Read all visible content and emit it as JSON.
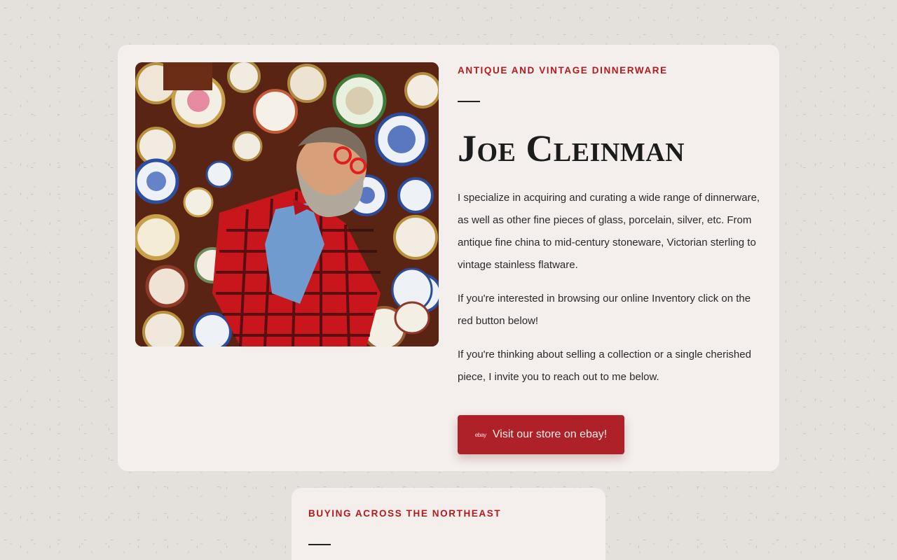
{
  "intro": {
    "eyebrow": "ANTIQUE AND VINTAGE DINNERWARE",
    "name": "Joe Cleinman",
    "paragraphs": [
      "I specialize in acquiring and curating a wide range of dinnerware, as well as other fine pieces of glass, porcelain, silver, etc. From antique fine china to mid-century stoneware, Victorian sterling to vintage stainless flatware.",
      "If you're interested in browsing our online Inventory click on the red button below!",
      "If you're thinking about selling a collection or a single cherished piece, I invite you to reach out to me below."
    ],
    "button": {
      "logo_text": "ebay",
      "label": "Visit our store on ebay!",
      "color": "#ae2128"
    }
  },
  "buying": {
    "eyebrow": "BUYING ACROSS THE NORTHEAST"
  },
  "colors": {
    "accent": "#b31b1b",
    "background": "#e4e0dc",
    "card": "#f4efed"
  }
}
